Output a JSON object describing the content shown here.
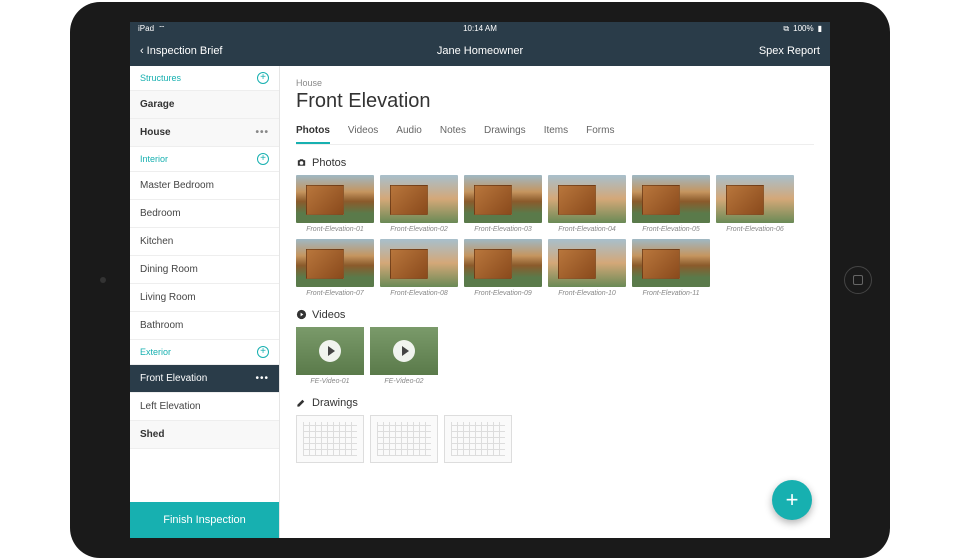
{
  "status": {
    "carrier": "iPad",
    "time": "10:14 AM",
    "battery": "100%"
  },
  "nav": {
    "back": "Inspection Brief",
    "title": "Jane Homeowner",
    "right": "Spex Report"
  },
  "sidebar": {
    "sections": [
      {
        "header": "Structures",
        "items": [
          {
            "label": "Garage",
            "bold": true
          },
          {
            "label": "House",
            "bold": true,
            "dots": true
          }
        ]
      },
      {
        "header": "Interior",
        "items": [
          {
            "label": "Master Bedroom"
          },
          {
            "label": "Bedroom"
          },
          {
            "label": "Kitchen"
          },
          {
            "label": "Dining Room"
          },
          {
            "label": "Living Room"
          },
          {
            "label": "Bathroom"
          }
        ]
      },
      {
        "header": "Exterior",
        "items": [
          {
            "label": "Front Elevation",
            "active": true,
            "dots": true
          },
          {
            "label": "Left Elevation"
          },
          {
            "label": "Shed",
            "bold": true
          }
        ]
      }
    ],
    "finish": "Finish Inspection"
  },
  "main": {
    "breadcrumb": "House",
    "title": "Front Elevation",
    "tabs": [
      "Photos",
      "Videos",
      "Audio",
      "Notes",
      "Drawings",
      "Items",
      "Forms"
    ],
    "activeTab": 0,
    "sections": {
      "photos": {
        "title": "Photos",
        "items": [
          "Front-Elevation-01",
          "Front-Elevation-02",
          "Front-Elevation-03",
          "Front-Elevation-04",
          "Front-Elevation-05",
          "Front-Elevation-06",
          "Front-Elevation-07",
          "Front-Elevation-08",
          "Front-Elevation-09",
          "Front-Elevation-10",
          "Front-Elevation-11"
        ]
      },
      "videos": {
        "title": "Videos",
        "items": [
          "FE-Video-01",
          "FE-Video-02"
        ]
      },
      "drawings": {
        "title": "Drawings",
        "items": [
          "",
          "",
          ""
        ]
      }
    }
  }
}
